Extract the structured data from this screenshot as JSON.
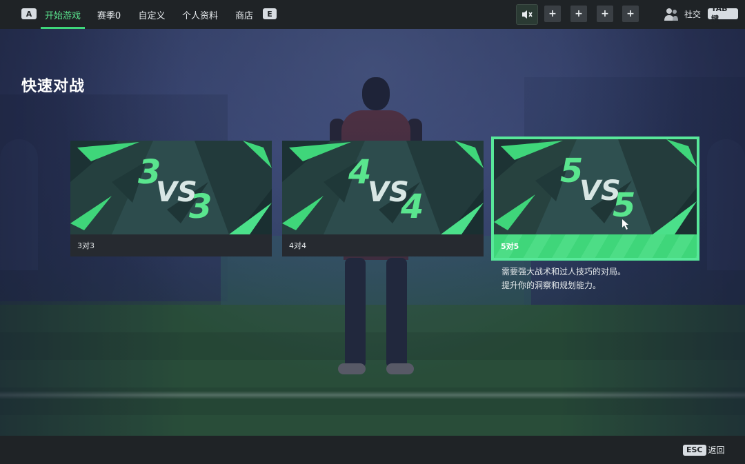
{
  "nav": {
    "left_key": "A",
    "right_key": "E",
    "tabs": [
      {
        "label": "开始游戏",
        "active": true
      },
      {
        "label": "赛季0",
        "active": false
      },
      {
        "label": "自定义",
        "active": false
      },
      {
        "label": "个人资料",
        "active": false
      },
      {
        "label": "商店",
        "active": false
      }
    ]
  },
  "party": {
    "mute_icon": "speaker-muted-icon",
    "slot_icon": "plus-icon"
  },
  "social": {
    "icon": "friends-icon",
    "label": "社交",
    "key": "TAB键"
  },
  "page": {
    "title": "快速对战"
  },
  "modes": [
    {
      "label": "3对3",
      "art_left": "3",
      "art_vs": "VS",
      "art_right": "3",
      "selected": false
    },
    {
      "label": "4对4",
      "art_left": "4",
      "art_vs": "VS",
      "art_right": "4",
      "selected": false
    },
    {
      "label": "5对5",
      "art_left": "5",
      "art_vs": "VS",
      "art_right": "5",
      "selected": true
    }
  ],
  "description": {
    "line1": "需要强大战术和过人技巧的对局。",
    "line2": "提升你的洞察和规划能力。"
  },
  "footer": {
    "back_key": "ESC",
    "back_label": "返回"
  },
  "colors": {
    "accent": "#3fd67a",
    "accent_light": "#58e89a",
    "bar_bg": "#1f2326"
  }
}
